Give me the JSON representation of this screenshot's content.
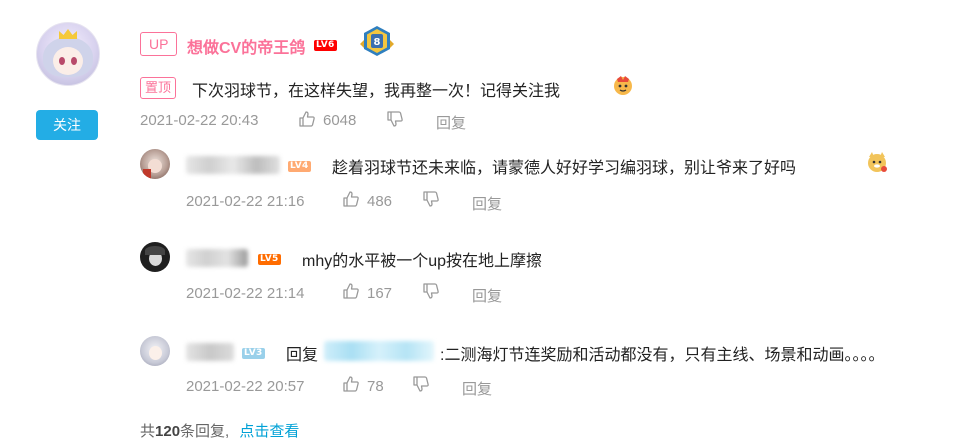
{
  "main_comment": {
    "up_badge": "UP",
    "username": "想做CV的帝王鸽",
    "level": "LV6",
    "pin_badge": "置顶",
    "content": "下次羽球节，在这样失望，我再整一次！记得关注我",
    "time": "2021-02-22 20:43",
    "likes": "6048",
    "reply_label": "回复",
    "follow_label": "关注"
  },
  "replies": [
    {
      "level": "LV4",
      "content": "趁着羽球节还未来临，请蒙德人好好学习编羽球，别让爷来了好吗",
      "time": "2021-02-22 21:16",
      "likes": "486",
      "reply_label": "回复"
    },
    {
      "level": "LV5",
      "content": "mhy的水平被一个up按在地上摩擦",
      "time": "2021-02-22 21:14",
      "likes": "167",
      "reply_label": "回复"
    },
    {
      "level": "LV3",
      "reply_prefix": "回复",
      "content": ":二测海灯节连奖励和活动都没有，只有主线、场景和动画。。。。",
      "time": "2021-02-22 20:57",
      "likes": "78",
      "reply_label": "回复"
    }
  ],
  "footer": {
    "prefix": "共",
    "count": "120",
    "suffix": "条回复,",
    "view_more": "点击查看"
  },
  "colors": {
    "pink": "#fb7299",
    "blue": "#00a1d6",
    "follow_bg": "#23ade5",
    "meta": "#999999"
  },
  "icons": [
    "like-icon",
    "dislike-icon",
    "emoji-icon",
    "medal-icon"
  ]
}
